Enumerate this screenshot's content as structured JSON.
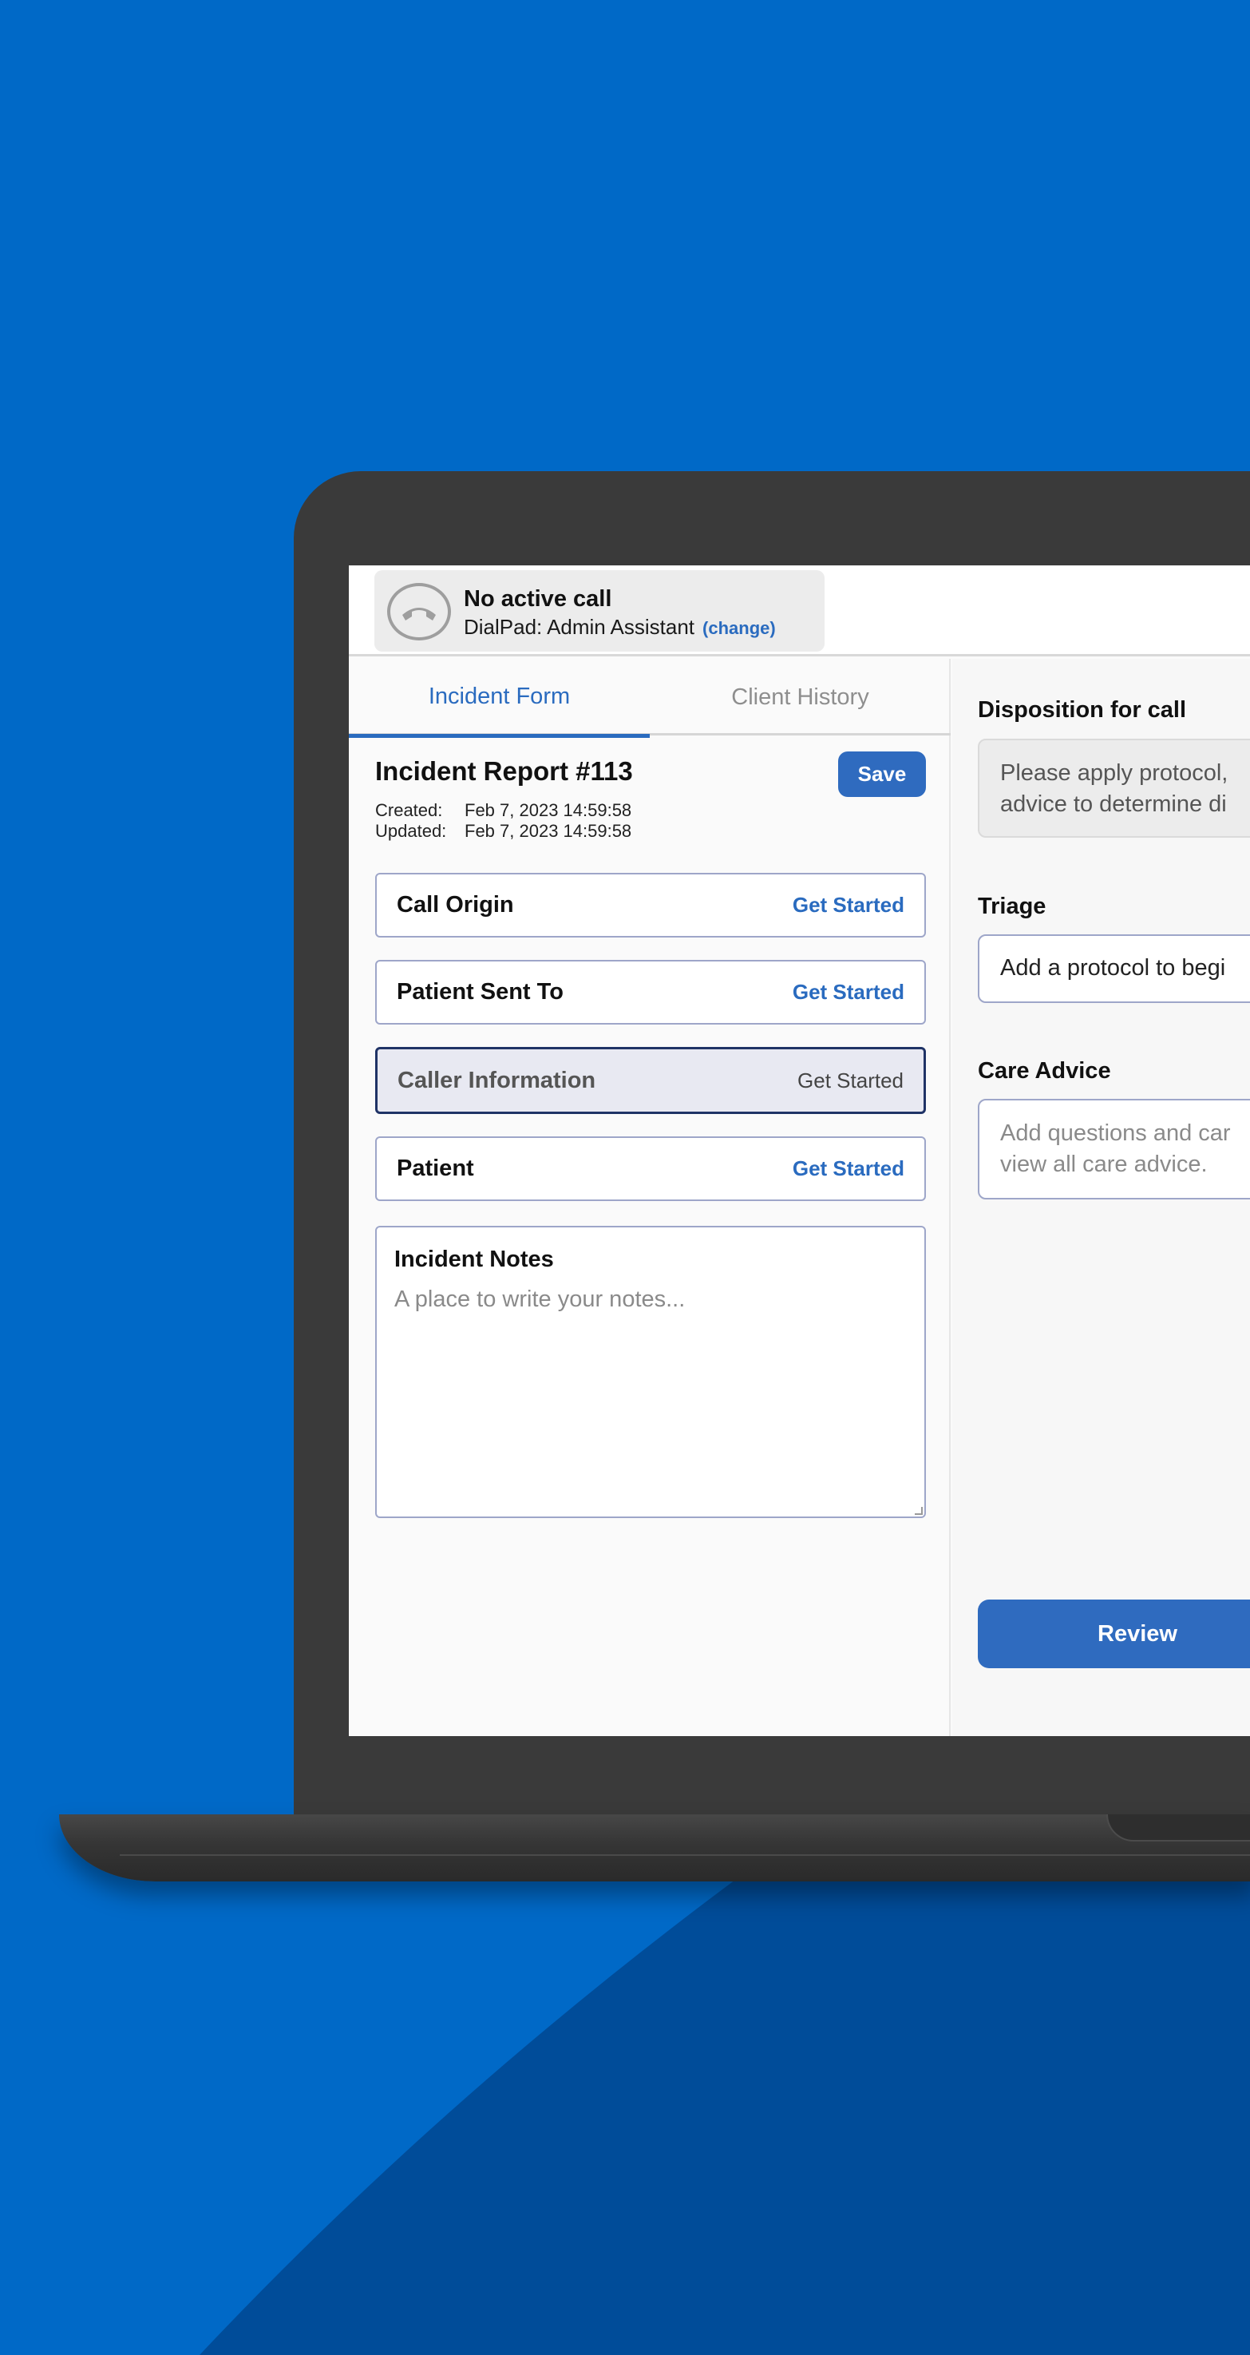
{
  "call": {
    "status": "No active call",
    "line": "DialPad: Admin Assistant",
    "change_label": "(change)"
  },
  "tabs": [
    {
      "label": "Incident Form",
      "active": true
    },
    {
      "label": "Client History",
      "active": false
    }
  ],
  "report": {
    "title": "Incident Report #113",
    "save_label": "Save",
    "created_label": "Created:",
    "created_value": "Feb 7, 2023 14:59:58",
    "updated_label": "Updated:",
    "updated_value": "Feb 7, 2023 14:59:58"
  },
  "sections": [
    {
      "label": "Call Origin",
      "action": "Get Started",
      "selected": false
    },
    {
      "label": "Patient Sent To",
      "action": "Get Started",
      "selected": false
    },
    {
      "label": "Caller Information",
      "action": "Get Started",
      "selected": true
    },
    {
      "label": "Patient",
      "action": "Get Started",
      "selected": false
    }
  ],
  "notes": {
    "title": "Incident Notes",
    "placeholder": "A place to write your notes..."
  },
  "right": {
    "disposition_label": "Disposition for call",
    "disposition_text_1": "Please apply protocol,",
    "disposition_text_2": "advice to determine di",
    "triage_label": "Triage",
    "triage_text": "Add a protocol to begi",
    "care_label": "Care Advice",
    "care_text_1": "Add questions and car",
    "care_text_2": "view all care advice.",
    "review_label": "Review"
  },
  "colors": {
    "background": "#0069c7",
    "accent": "#2f6bbf",
    "selected_border": "#1f3366"
  }
}
